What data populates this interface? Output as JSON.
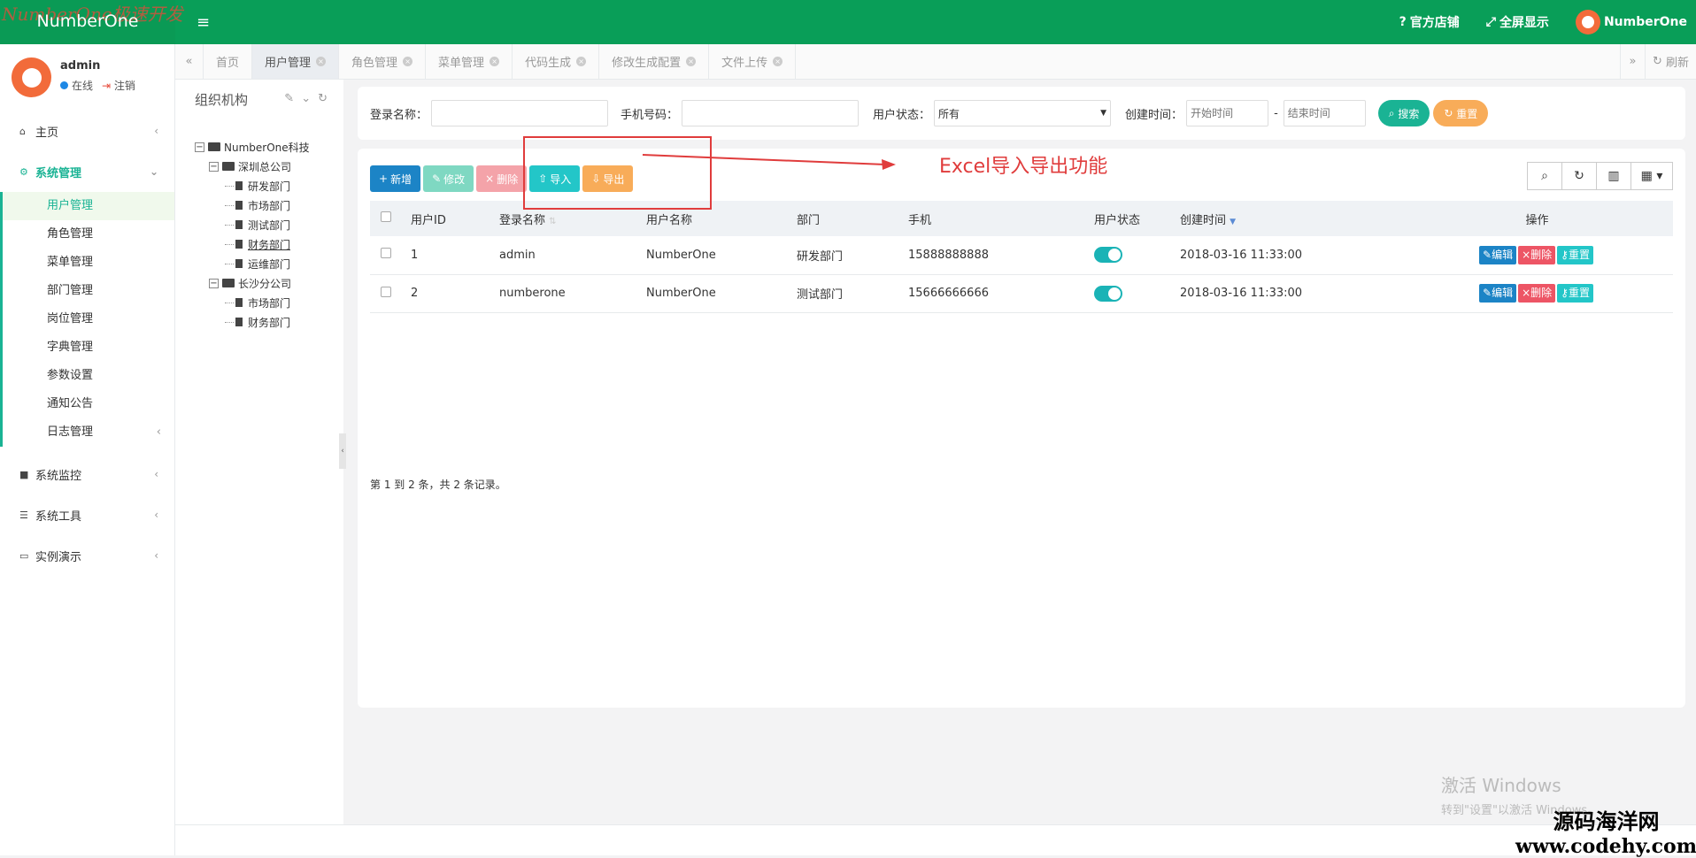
{
  "app": {
    "watermark": "NumberOne极速开发",
    "name": "NumberOne"
  },
  "header": {
    "official_store": "官方店铺",
    "fullscreen": "全屏显示",
    "username": "NumberOne"
  },
  "user": {
    "name": "admin",
    "status": "在线",
    "logout": "注销"
  },
  "sidebar": {
    "home": "主页",
    "system_management": "系统管理",
    "sub_items": [
      "用户管理",
      "角色管理",
      "菜单管理",
      "部门管理",
      "岗位管理",
      "字典管理",
      "参数设置",
      "通知公告",
      "日志管理"
    ],
    "system_monitor": "系统监控",
    "system_tools": "系统工具",
    "demo": "实例演示"
  },
  "tabs": {
    "home": "首页",
    "items": [
      "用户管理",
      "角色管理",
      "菜单管理",
      "代码生成",
      "修改生成配置",
      "文件上传"
    ],
    "refresh": "刷新"
  },
  "org": {
    "title": "组织机构",
    "root": "NumberOne科技",
    "branch1": "深圳总公司",
    "branch1_children": [
      "研发部门",
      "市场部门",
      "测试部门",
      "财务部门",
      "运维部门"
    ],
    "branch2": "长沙分公司",
    "branch2_children": [
      "市场部门",
      "财务部门"
    ]
  },
  "search": {
    "login_name_label": "登录名称：",
    "phone_label": "手机号码：",
    "status_label": "用户状态：",
    "status_value": "所有",
    "created_label": "创建时间：",
    "start_placeholder": "开始时间",
    "range_sep": "-",
    "end_placeholder": "结束时间",
    "search_btn": "搜索",
    "reset_btn": "重置"
  },
  "toolbar": {
    "add": "新增",
    "edit": "修改",
    "delete": "删除",
    "import": "导入",
    "export": "导出"
  },
  "annotation": "Excel导入导出功能",
  "table": {
    "headers": [
      "用户ID",
      "登录名称",
      "用户名称",
      "部门",
      "手机",
      "用户状态",
      "创建时间",
      "操作"
    ],
    "rows": [
      {
        "id": "1",
        "login": "admin",
        "name": "NumberOne",
        "dept": "研发部门",
        "phone": "15888888888",
        "created": "2018-03-16 11:33:00"
      },
      {
        "id": "2",
        "login": "numberone",
        "name": "NumberOne",
        "dept": "测试部门",
        "phone": "15666666666",
        "created": "2018-03-16 11:33:00"
      }
    ],
    "row_actions": {
      "edit": "编辑",
      "delete": "删除",
      "reset": "重置"
    }
  },
  "pagination": "第 1 到 2 条，共 2 条记录。",
  "windows_watermark": {
    "line1": "激活 Windows",
    "line2": "转到\"设置\"以激活 Windows。"
  },
  "site_watermark": {
    "line1": "源码海洋网",
    "line2": "www.codehy.com"
  },
  "colors": {
    "topbar": "#099e58",
    "accent": "#1ab394",
    "primary": "#1c84c6",
    "danger": "#ed5565",
    "warning": "#f8ac59",
    "info": "#23c6c8"
  }
}
